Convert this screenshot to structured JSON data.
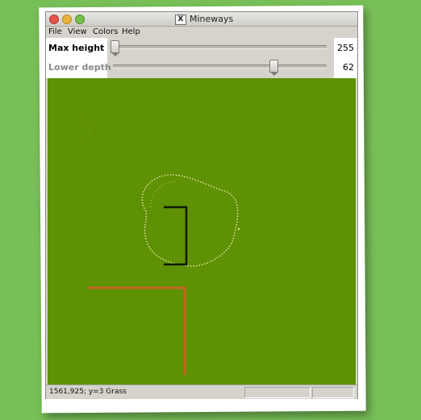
{
  "window": {
    "title": "Mineways",
    "app_icon": "X"
  },
  "menu": [
    {
      "label": "File"
    },
    {
      "label": "View"
    },
    {
      "label": "Colors"
    },
    {
      "label": "Help"
    }
  ],
  "controls": {
    "max_height": {
      "label": "Max height",
      "value": "255"
    },
    "lower_depth": {
      "label": "Lower depth",
      "value": "62"
    }
  },
  "map": {
    "ground_color": "#5e9104"
  },
  "status": {
    "text": "1561,925; y=3 Grass"
  }
}
